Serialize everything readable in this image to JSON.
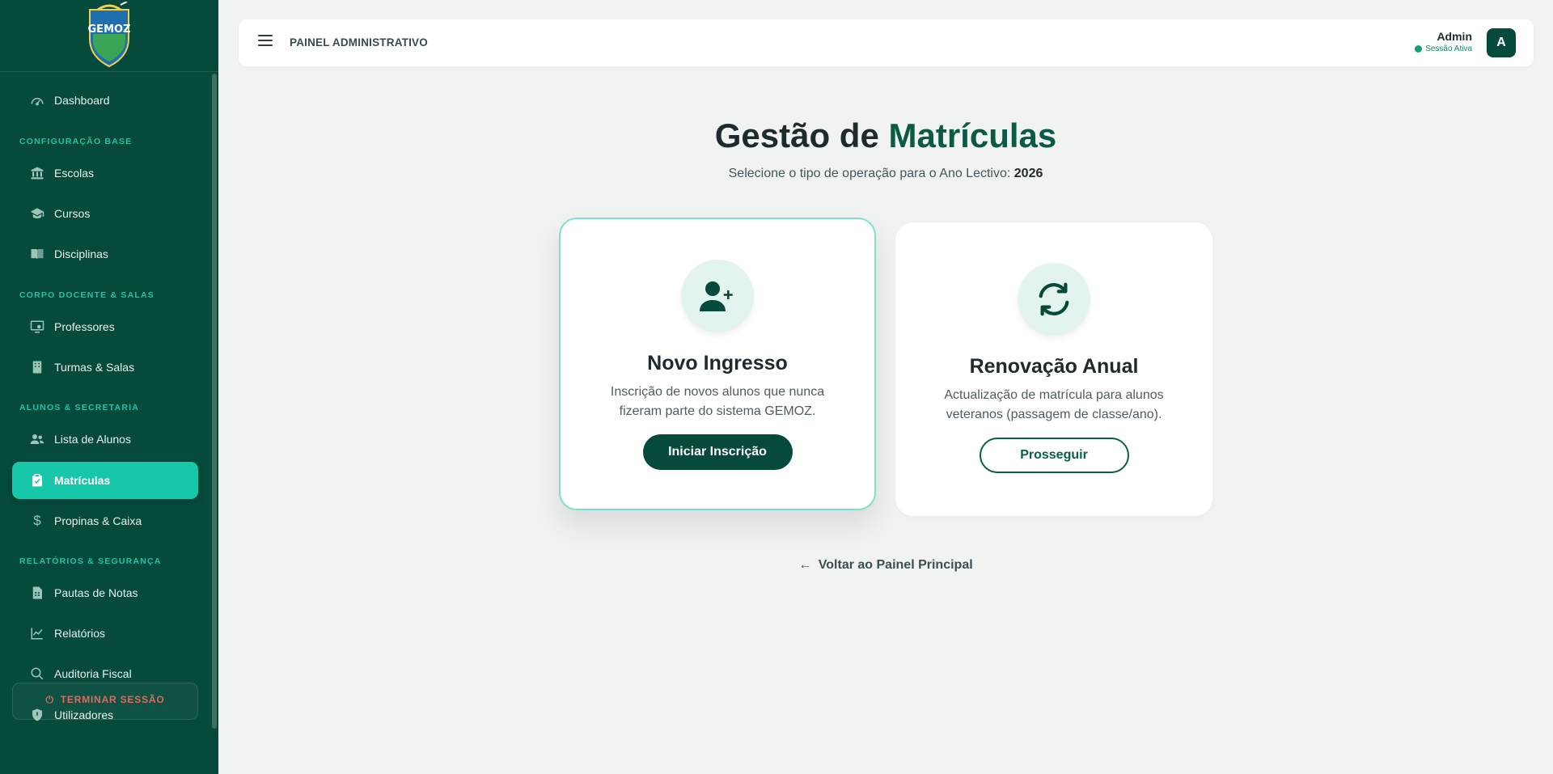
{
  "sidebar": {
    "logo_text": "GEMOZ",
    "items": [
      {
        "label": "Dashboard",
        "icon": "dashboard-gauge-icon"
      },
      {
        "label": "Escolas",
        "icon": "school-building-icon"
      },
      {
        "label": "Cursos",
        "icon": "graduation-cap-icon"
      },
      {
        "label": "Disciplinas",
        "icon": "book-icon"
      },
      {
        "label": "Professores",
        "icon": "teacher-board-icon"
      },
      {
        "label": "Turmas & Salas",
        "icon": "building-icon"
      },
      {
        "label": "Lista de Alunos",
        "icon": "users-icon"
      },
      {
        "label": "Matrículas",
        "icon": "clipboard-icon",
        "active": true
      },
      {
        "label": "Propinas & Caixa",
        "icon": "dollar-icon"
      },
      {
        "label": "Pautas de Notas",
        "icon": "spreadsheet-icon"
      },
      {
        "label": "Relatórios",
        "icon": "chart-line-icon"
      },
      {
        "label": "Auditoria Fiscal",
        "icon": "search-icon"
      },
      {
        "label": "Utilizadores",
        "icon": "shield-icon"
      }
    ],
    "sections": [
      "CONFIGURAÇÃO BASE",
      "CORPO DOCENTE & SALAS",
      "ALUNOS & SECRETARIA",
      "RELATÓRIOS & SEGURANÇA"
    ],
    "logout_label": "TERMINAR SESSÃO"
  },
  "topbar": {
    "title": "PAINEL ADMINISTRATIVO",
    "user_name": "Admin",
    "user_status": "Sessão Ativa",
    "avatar_letter": "A"
  },
  "main": {
    "heading_part1": "Gestão de ",
    "heading_part2": "Matrículas",
    "subtitle": "Selecione o tipo de operação para o Ano Lectivo: ",
    "year": "2026",
    "cards": [
      {
        "title": "Novo Ingresso",
        "description": "Inscrição de novos alunos que nunca fizeram parte do sistema GEMOZ.",
        "button": "Iniciar Inscrição",
        "icon": "user-plus-icon"
      },
      {
        "title": "Renovação Anual",
        "description": "Actualização de matrícula para alunos veteranos (passagem de classe/ano).",
        "button": "Prosseguir",
        "icon": "refresh-icon"
      }
    ],
    "back_arrow": "←",
    "back_link": "Voltar ao Painel Principal"
  },
  "colors": {
    "sidebar_bg": "#064a3c",
    "active_item": "#17c7a9",
    "section_label": "#25c2a3",
    "primary": "#064a3c",
    "accent_text": "#0a5a46",
    "page_bg": "#f1f3f2"
  }
}
